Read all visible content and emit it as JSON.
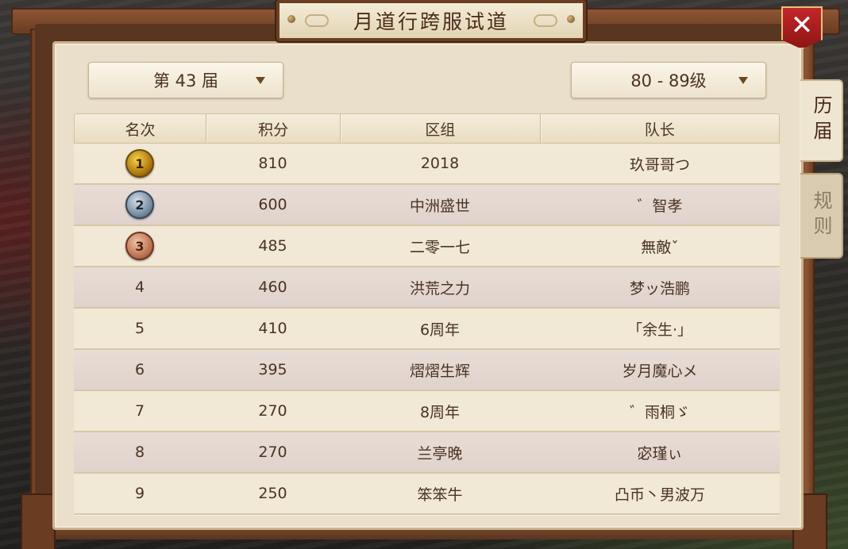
{
  "window": {
    "title": "月道行跨服试道",
    "close_label": "✕"
  },
  "filters": {
    "session": "第 43 届",
    "level": "80 - 89级"
  },
  "side_tabs": {
    "history": "历届",
    "rules": "规则"
  },
  "table": {
    "headers": [
      "名次",
      "积分",
      "区组",
      "队长"
    ],
    "rows": [
      {
        "rank": "1",
        "score": "810",
        "group": "2018",
        "captain": "玖哥哥つ",
        "medal": "gold"
      },
      {
        "rank": "2",
        "score": "600",
        "group": "中洲盛世",
        "captain": "゛智孝",
        "medal": "silver"
      },
      {
        "rank": "3",
        "score": "485",
        "group": "二零一七",
        "captain": "無敵ˇ",
        "medal": "bronze"
      },
      {
        "rank": "4",
        "score": "460",
        "group": "洪荒之力",
        "captain": "梦ッ浩鹏"
      },
      {
        "rank": "5",
        "score": "410",
        "group": "6周年",
        "captain": "「余生·」"
      },
      {
        "rank": "6",
        "score": "395",
        "group": "熠熠生辉",
        "captain": "岁月魔心メ"
      },
      {
        "rank": "7",
        "score": "270",
        "group": "8周年",
        "captain": "゛雨桐ゞ"
      },
      {
        "rank": "8",
        "score": "270",
        "group": "兰亭晚",
        "captain": "宓瑾ぃ"
      },
      {
        "rank": "9",
        "score": "250",
        "group": "笨笨牛",
        "captain": "凸币丶男波万"
      }
    ]
  },
  "colors": {
    "panel": "#e9dfca",
    "frame": "#7a4a2e",
    "close_red": "#c3272a",
    "text": "#4a3322"
  }
}
